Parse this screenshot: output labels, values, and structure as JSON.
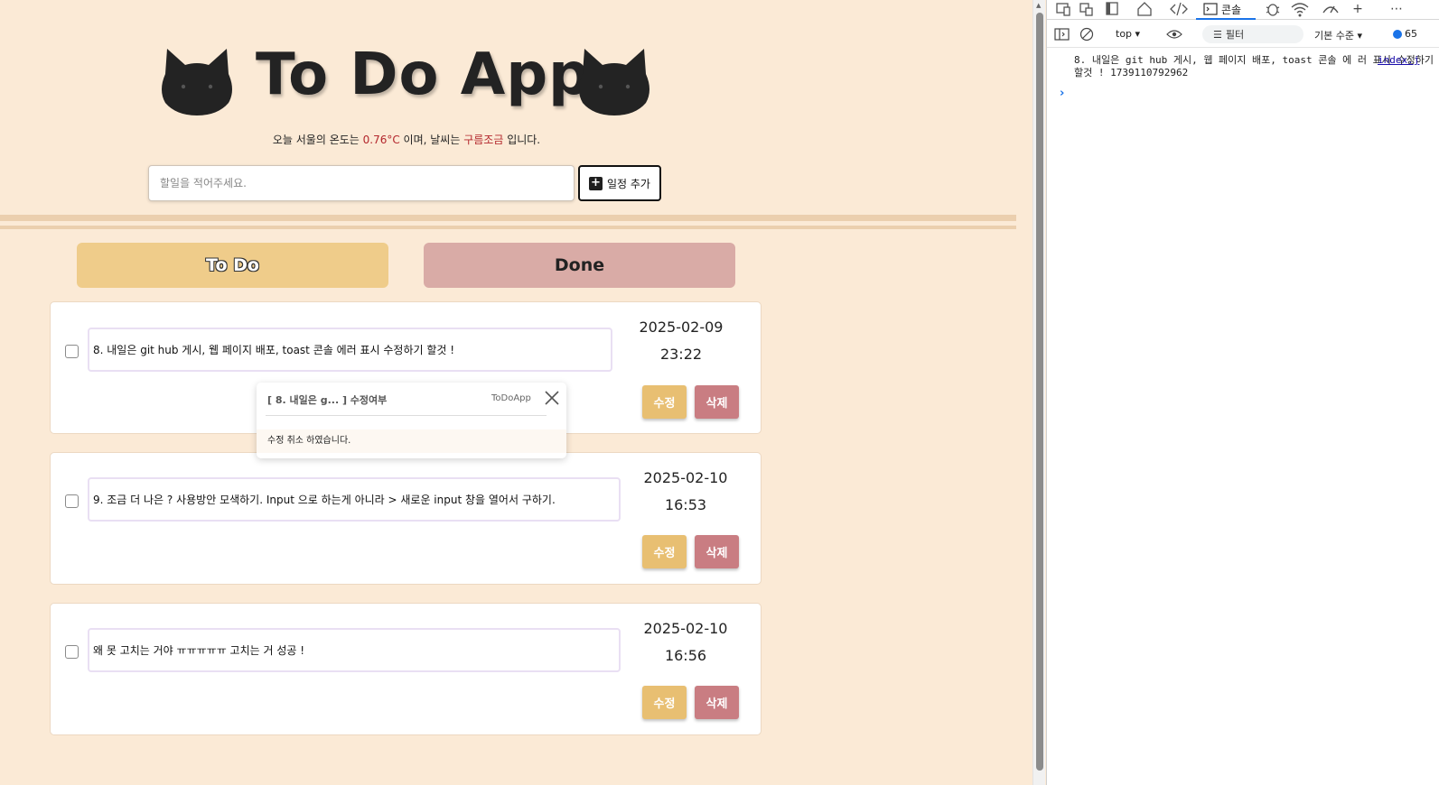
{
  "app": {
    "title": "To Do App",
    "weather": {
      "prefix": "오늘 서울의 온도는 ",
      "temp": "0.76°C",
      "mid": " 이며, 날씨는 ",
      "condition": "구름조금",
      "suffix": " 입니다."
    },
    "add_input": {
      "placeholder": "할일을 적어주세요.",
      "value": ""
    },
    "add_button_label": "일정 추가",
    "tabs": {
      "todo": "To Do",
      "done": "Done"
    },
    "todos": [
      {
        "text": "8. 내일은 git hub 게시, 웹 페이지 배포, toast 콘솔 에러 표시 수정하기 할것 !",
        "date": "2025-02-09",
        "time": "23:22",
        "edit_label": "수정",
        "delete_label": "삭제"
      },
      {
        "text": "9. 조금 더 나은 ? 사용방안 모색하기. Input 으로 하는게 아니라 > 새로운 input 창을 열어서 구하기.",
        "date": "2025-02-10",
        "time": "16:53",
        "edit_label": "수정",
        "delete_label": "삭제"
      },
      {
        "text": "왜 못 고치는 거야 ㅠㅠㅠㅠㅠ 고치는 거 성공 !",
        "date": "2025-02-10",
        "time": "16:56",
        "edit_label": "수정",
        "delete_label": "삭제"
      }
    ],
    "toast": {
      "title": "[ 8. 내일은 g... ] 수정여부",
      "app_name": "ToDoApp",
      "body": "수정 취소 하였습니다."
    },
    "colors": {
      "background": "#fbead6",
      "todo_tab": "#efcc8a",
      "done_tab": "#d9aba6",
      "edit_button": "#e8bf72",
      "delete_button": "#c97d82",
      "highlight_text": "#b3262c"
    }
  },
  "devtools": {
    "console_tab_label": "콘솔",
    "context": "top",
    "filter_placeholder": "필터",
    "level": "기본 수준",
    "issues_count": "65",
    "log": {
      "message": "8. 내일은 git hub 게시, 웹 페이지 배포, toast 콘솔 에 러 표시 수정하기 할것 ! 1739110792962",
      "source": "index.j"
    },
    "toolbar_icons": [
      "device-toggle-icon",
      "inspect-icon",
      "dock-icon",
      "home-icon",
      "elements-icon",
      "sources-icon",
      "network-icon",
      "performance-icon",
      "add-tab-icon",
      "more-icon"
    ]
  }
}
